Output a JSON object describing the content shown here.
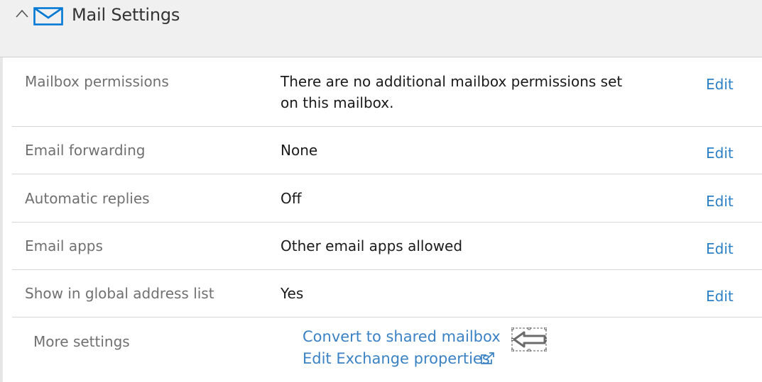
{
  "section": {
    "title": "Mail Settings",
    "collapse_icon": "chevron-up-icon",
    "icon": "mail-envelope-icon",
    "accent_color": "#0078d4"
  },
  "rows": [
    {
      "label": "Mailbox permissions",
      "value_line1": "There are no additional mailbox permissions set",
      "value_line2": "on this mailbox.",
      "action": "Edit"
    },
    {
      "label": "Email forwarding",
      "value": "None",
      "action": "Edit"
    },
    {
      "label": "Automatic replies",
      "value": "Off",
      "action": "Edit"
    },
    {
      "label": "Email apps",
      "value": "Other email apps allowed",
      "action": "Edit"
    },
    {
      "label": "Show in global address list",
      "value": "Yes",
      "action": "Edit"
    }
  ],
  "more_settings": {
    "label": "More settings",
    "convert_link": "Convert to shared mailbox",
    "exchange_link": "Edit Exchange properties",
    "exchange_icon": "external-link-icon",
    "pointer_icon": "left-arrow-callout-icon"
  },
  "colors": {
    "link": "#2b7fc5",
    "label": "#707070",
    "header_bg": "#f0f0f0"
  }
}
